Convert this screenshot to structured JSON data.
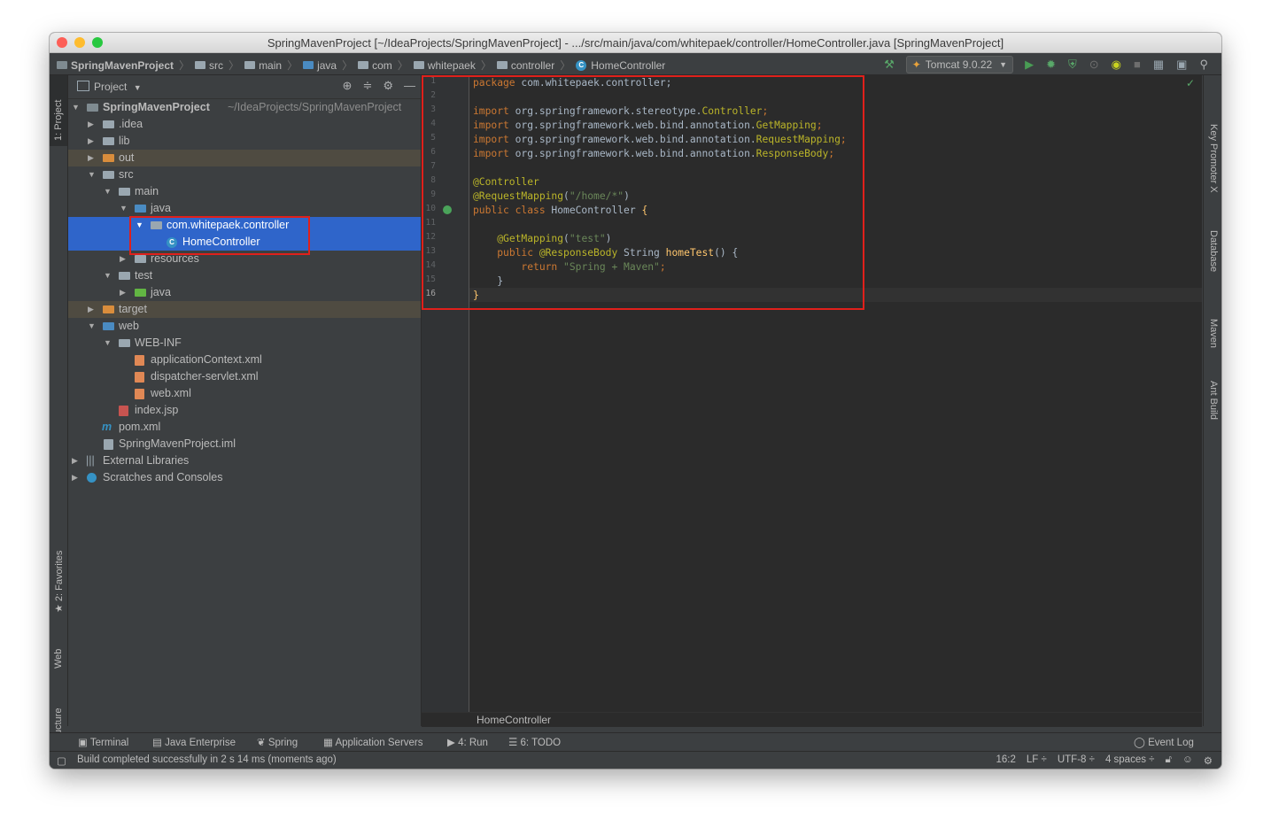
{
  "window": {
    "title": "SpringMavenProject [~/IdeaProjects/SpringMavenProject] - .../src/main/java/com/whitepaek/controller/HomeController.java [SpringMavenProject]"
  },
  "breadcrumbs": [
    "SpringMavenProject",
    "src",
    "main",
    "java",
    "com",
    "whitepaek",
    "controller",
    "HomeController"
  ],
  "run_config": "Tomcat 9.0.22",
  "left_tabs": {
    "project": "1: Project",
    "favorites": "2: Favorites",
    "web": "Web",
    "structure": "Z: Structure"
  },
  "right_tabs": {
    "key_promoter": "Key Promoter X",
    "database": "Database",
    "maven": "Maven",
    "ant": "Ant Build"
  },
  "project_panel": {
    "title": "Project"
  },
  "tree": [
    {
      "label": "SpringMavenProject",
      "path": "~/IdeaProjects/SpringMavenProject"
    },
    {
      "label": ".idea"
    },
    {
      "label": "lib"
    },
    {
      "label": "out"
    },
    {
      "label": "src"
    },
    {
      "label": "main"
    },
    {
      "label": "java"
    },
    {
      "label": "com.whitepaek.controller"
    },
    {
      "label": "HomeController"
    },
    {
      "label": "resources"
    },
    {
      "label": "test"
    },
    {
      "label": "java"
    },
    {
      "label": "target"
    },
    {
      "label": "web"
    },
    {
      "label": "WEB-INF"
    },
    {
      "label": "applicationContext.xml"
    },
    {
      "label": "dispatcher-servlet.xml"
    },
    {
      "label": "web.xml"
    },
    {
      "label": "index.jsp"
    },
    {
      "label": "pom.xml"
    },
    {
      "label": "SpringMavenProject.iml"
    },
    {
      "label": "External Libraries"
    },
    {
      "label": "Scratches and Consoles"
    }
  ],
  "editor": {
    "line_numbers": [
      "1",
      "2",
      "3",
      "4",
      "5",
      "6",
      "7",
      "8",
      "9",
      "10",
      "11",
      "12",
      "13",
      "14",
      "15",
      "16"
    ],
    "code": {
      "l1_kw": "package",
      "l1_rest": " com.whitepaek.controller;",
      "import_kw": "import",
      "l3_pkg": " org.springframework.stereotype.",
      "l3_cls": "Controller",
      "l4_pkg": " org.springframework.web.bind.annotation.",
      "l4_cls": "GetMapping",
      "l5_pkg": " org.springframework.web.bind.annotation.",
      "l5_cls": "RequestMapping",
      "l6_pkg": " org.springframework.web.bind.annotation.",
      "l6_cls": "ResponseBody",
      "l8_ann": "@Controller",
      "l9_ann": "@RequestMapping",
      "l9_arg": "\"/home/*\"",
      "l10_kw": "public class",
      "l10_name": " HomeController ",
      "l12_ann": "@GetMapping",
      "l12_arg": "\"test\"",
      "l13_kw": "public",
      "l13_ann": " @ResponseBody",
      "l13_type": " String ",
      "l13_fn": "homeTest",
      "l13_rest": "() {",
      "l14_kw": "return",
      "l14_str": " \"Spring + Maven\"",
      "l15": "}",
      "l16": "}"
    },
    "tab_name": "HomeController"
  },
  "tool_windows": {
    "terminal": "Terminal",
    "java_enterprise": "Java Enterprise",
    "spring": "Spring",
    "app_servers": "Application Servers",
    "run": "4: Run",
    "todo": "6: TODO",
    "event_log": "Event Log"
  },
  "status": {
    "message": "Build completed successfully in 2 s 14 ms (moments ago)",
    "position": "16:2",
    "line_sep": "LF ÷",
    "encoding": "UTF-8 ÷",
    "indent": "4 spaces ÷"
  },
  "colors": {
    "selection": "#2f65ca",
    "highlight_box": "#e0201b",
    "keyword": "#cc7832",
    "annotation": "#bbb529",
    "string": "#6a8759"
  }
}
